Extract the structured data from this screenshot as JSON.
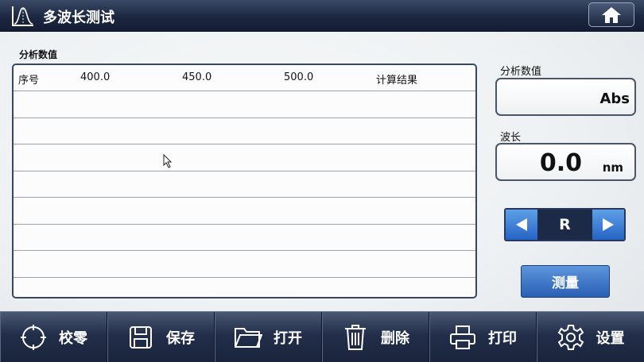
{
  "title": "多波长测试",
  "table": {
    "label": "分析数值",
    "headers": [
      "序号",
      "400.0",
      "450.0",
      "500.0",
      "计算结果"
    ],
    "rows": [
      [
        "",
        "",
        "",
        "",
        ""
      ],
      [
        "",
        "",
        "",
        "",
        ""
      ],
      [
        "",
        "",
        "",
        "",
        ""
      ],
      [
        "",
        "",
        "",
        "",
        ""
      ],
      [
        "",
        "",
        "",
        "",
        ""
      ],
      [
        "",
        "",
        "",
        "",
        ""
      ],
      [
        "",
        "",
        "",
        "",
        ""
      ],
      [
        "",
        "",
        "",
        "",
        ""
      ]
    ]
  },
  "analysis": {
    "label": "分析数值",
    "value": "",
    "unit": "Abs"
  },
  "wavelength": {
    "label": "波长",
    "value": "0.0",
    "unit": "nm"
  },
  "selector": {
    "value": "R"
  },
  "measure_label": "测量",
  "toolbar": [
    {
      "label": "校零",
      "icon": "zero-icon"
    },
    {
      "label": "保存",
      "icon": "save-icon"
    },
    {
      "label": "打开",
      "icon": "folder-icon"
    },
    {
      "label": "删除",
      "icon": "trash-icon"
    },
    {
      "label": "打印",
      "icon": "printer-icon"
    },
    {
      "label": "设置",
      "icon": "gear-icon"
    }
  ],
  "colors": {
    "titlebar": "#1c2740",
    "accent": "#2a5fb4",
    "selector": "#1c2a48"
  }
}
